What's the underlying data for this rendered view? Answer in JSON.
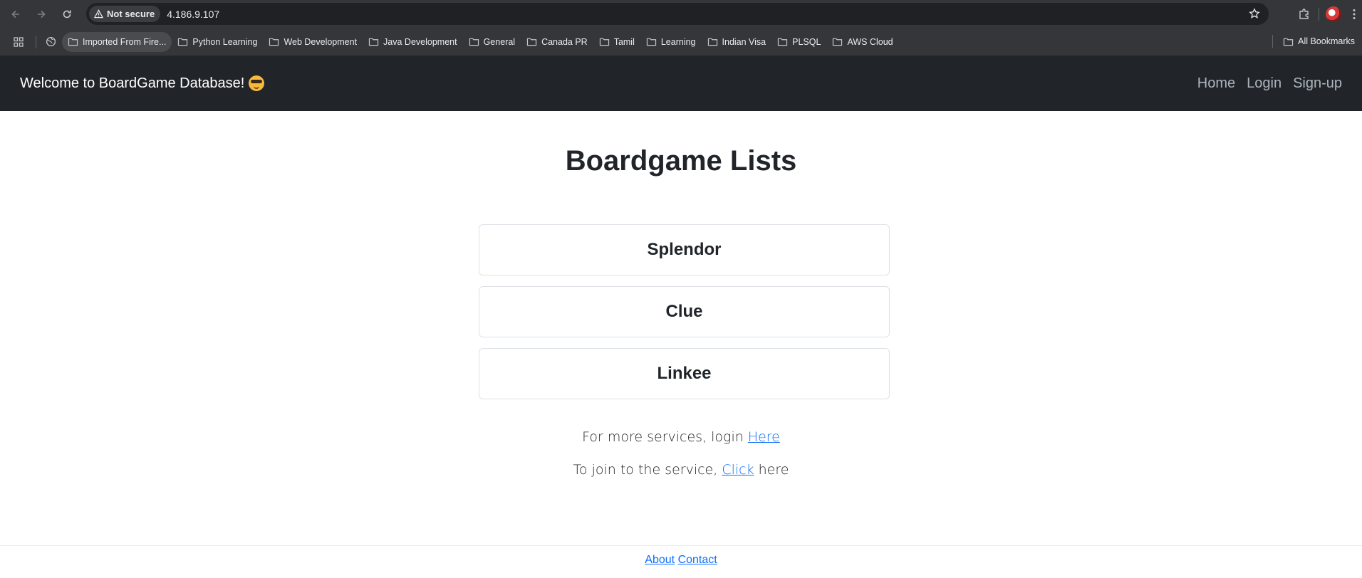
{
  "browser": {
    "security_label": "Not secure",
    "url": "4.186.9.107",
    "bookmarks": [
      "Imported From Fire...",
      "Python Learning",
      "Web Development",
      "Java Development",
      "General",
      "Canada PR",
      "Tamil",
      "Learning",
      "Indian Visa",
      "PLSQL",
      "AWS Cloud"
    ],
    "all_bookmarks_label": "All Bookmarks"
  },
  "navbar": {
    "brand": "Welcome to BoardGame Database!",
    "links": [
      "Home",
      "Login",
      "Sign-up"
    ]
  },
  "main": {
    "title": "Boardgame Lists",
    "games": [
      "Splendor",
      "Clue",
      "Linkee"
    ],
    "login_text": "For more services, login ",
    "login_link": "Here",
    "join_text": "To join to the service, ",
    "join_link": "Click",
    "join_suffix": " here"
  },
  "footer": {
    "about": "About",
    "contact": "Contact"
  },
  "colors": {
    "chrome_bg": "#35363a",
    "navbar_bg": "#212529",
    "link": "#0d6efd"
  }
}
